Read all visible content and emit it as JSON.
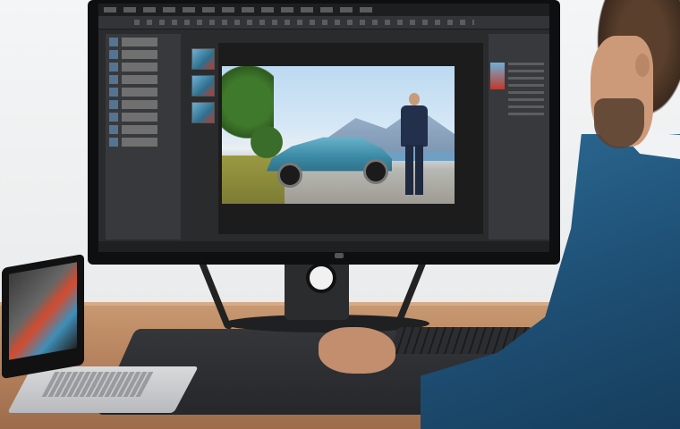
{
  "scene": {
    "description_tags": [
      "monitor",
      "photo-editor-ui",
      "laptop",
      "desk",
      "keyboard",
      "person"
    ]
  },
  "colors": {
    "editor_dark": "#2a2b2d",
    "shirt_blue": "#2d6c96",
    "desk_wood": "#b88560"
  }
}
